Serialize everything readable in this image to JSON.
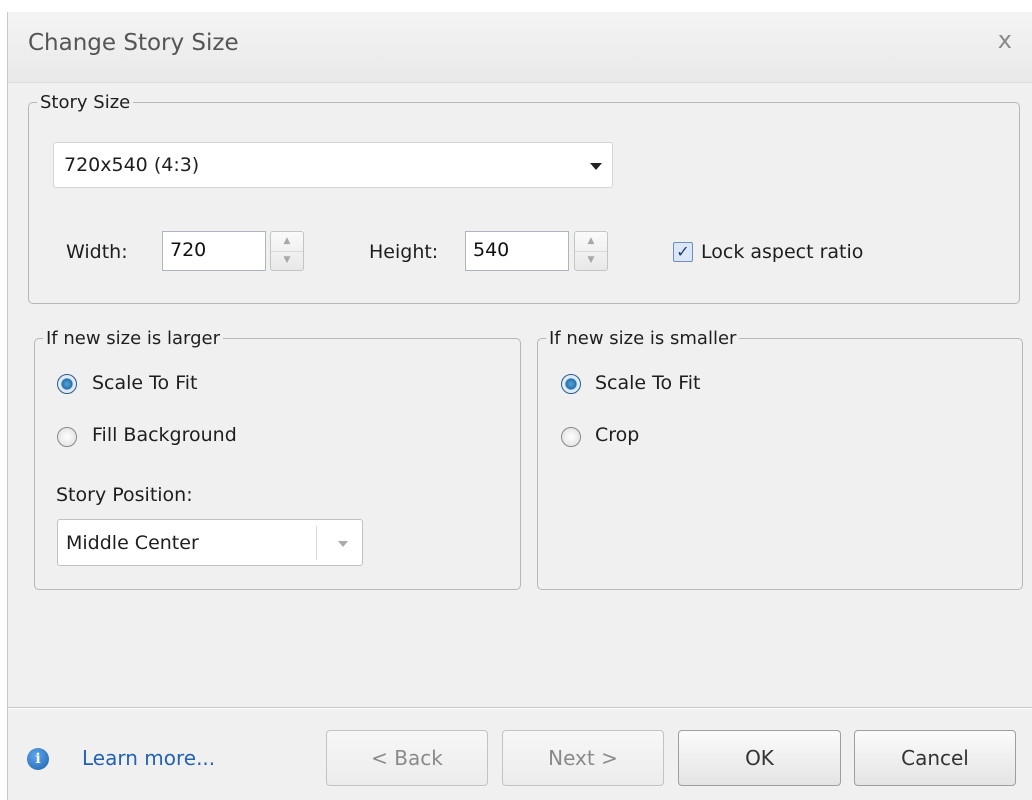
{
  "dialog": {
    "title": "Change Story Size",
    "close_glyph": "x"
  },
  "story_size": {
    "legend": "Story Size",
    "preset_value": "720x540 (4:3)",
    "width_label": "Width:",
    "width_value": "720",
    "height_label": "Height:",
    "height_value": "540",
    "lock_label": "Lock aspect ratio",
    "lock_checked": true
  },
  "larger": {
    "legend": "If new size is larger",
    "options": [
      "Scale To Fit",
      "Fill Background"
    ],
    "selected": "Scale To Fit",
    "position_label": "Story Position:",
    "position_value": "Middle Center"
  },
  "smaller": {
    "legend": "If new size is smaller",
    "options": [
      "Scale To Fit",
      "Crop"
    ],
    "selected": "Scale To Fit"
  },
  "footer": {
    "info_icon": "info-icon",
    "learn_more": "Learn more...",
    "back": "< Back",
    "next": "Next >",
    "ok": "OK",
    "cancel": "Cancel"
  },
  "colors": {
    "dialog_bg": "#f0f0f0",
    "link": "#2263b3",
    "radio_selected": "#2a72ad"
  }
}
